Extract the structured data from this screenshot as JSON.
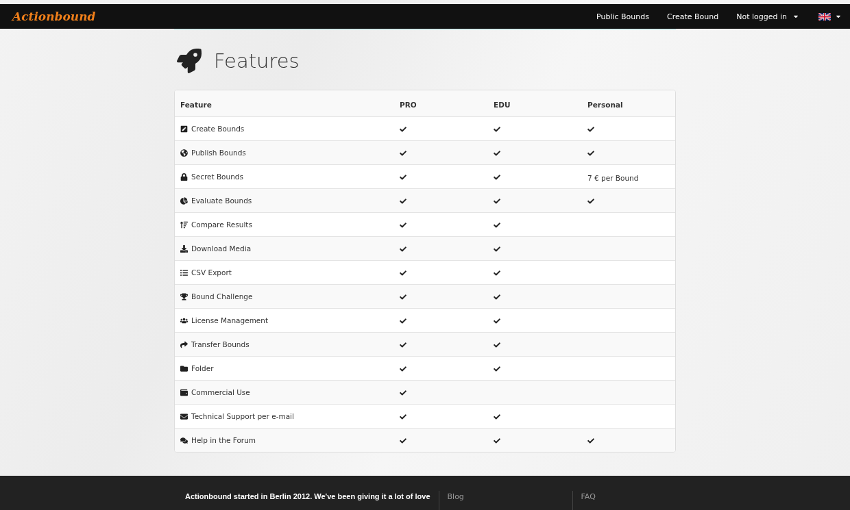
{
  "navbar": {
    "logo": "Actionbound",
    "links": [
      {
        "label": "Public Bounds",
        "kind": "link"
      },
      {
        "label": "Create Bound",
        "kind": "link"
      },
      {
        "label": "Not logged in",
        "kind": "dropdown"
      }
    ],
    "language": {
      "kind": "flag-uk"
    }
  },
  "page": {
    "title": "Features"
  },
  "table": {
    "columns": [
      "Feature",
      "PRO",
      "EDU",
      "Personal"
    ],
    "rows": [
      {
        "cells": [
          {
            "kind": "feature",
            "text": "Create Bounds"
          },
          {
            "kind": "check"
          },
          {
            "kind": "check"
          },
          {
            "kind": "check"
          }
        ]
      },
      {
        "cells": [
          {
            "kind": "feature",
            "text": "Publish Bounds"
          },
          {
            "kind": "check"
          },
          {
            "kind": "check"
          },
          {
            "kind": "check"
          }
        ]
      },
      {
        "cells": [
          {
            "kind": "feature",
            "text": "Secret Bounds"
          },
          {
            "kind": "check"
          },
          {
            "kind": "check"
          },
          {
            "kind": "text",
            "text": "7 € per Bound"
          }
        ]
      },
      {
        "cells": [
          {
            "kind": "feature",
            "text": "Evaluate Bounds"
          },
          {
            "kind": "check"
          },
          {
            "kind": "check"
          },
          {
            "kind": "check"
          }
        ]
      },
      {
        "cells": [
          {
            "kind": "feature",
            "text": "Compare Results"
          },
          {
            "kind": "check"
          },
          {
            "kind": "check"
          },
          {
            "kind": "none"
          }
        ]
      },
      {
        "cells": [
          {
            "kind": "feature",
            "text": "Download Media"
          },
          {
            "kind": "check"
          },
          {
            "kind": "check"
          },
          {
            "kind": "none"
          }
        ]
      },
      {
        "cells": [
          {
            "kind": "feature",
            "text": "CSV Export"
          },
          {
            "kind": "check"
          },
          {
            "kind": "check"
          },
          {
            "kind": "none"
          }
        ]
      },
      {
        "cells": [
          {
            "kind": "feature",
            "text": "Bound Challenge"
          },
          {
            "kind": "check"
          },
          {
            "kind": "check"
          },
          {
            "kind": "none"
          }
        ]
      },
      {
        "cells": [
          {
            "kind": "feature",
            "text": "License Management"
          },
          {
            "kind": "check"
          },
          {
            "kind": "check"
          },
          {
            "kind": "none"
          }
        ]
      },
      {
        "cells": [
          {
            "kind": "feature",
            "text": "Transfer Bounds"
          },
          {
            "kind": "check"
          },
          {
            "kind": "check"
          },
          {
            "kind": "none"
          }
        ]
      },
      {
        "cells": [
          {
            "kind": "feature",
            "text": "Folder"
          },
          {
            "kind": "check"
          },
          {
            "kind": "check"
          },
          {
            "kind": "none"
          }
        ]
      },
      {
        "cells": [
          {
            "kind": "feature",
            "text": "Commercial Use"
          },
          {
            "kind": "check"
          },
          {
            "kind": "none"
          },
          {
            "kind": "none"
          }
        ]
      },
      {
        "cells": [
          {
            "kind": "feature",
            "text": "Technical Support per e-mail"
          },
          {
            "kind": "check"
          },
          {
            "kind": "check"
          },
          {
            "kind": "none"
          }
        ]
      },
      {
        "cells": [
          {
            "kind": "feature",
            "text": "Help in the Forum"
          },
          {
            "kind": "check"
          },
          {
            "kind": "check"
          },
          {
            "kind": "check"
          }
        ]
      }
    ]
  },
  "footer": {
    "about": "Actionbound started in Berlin 2012. We've been giving it a lot of love",
    "columns": [
      [
        "Blog"
      ],
      [
        "FAQ"
      ]
    ]
  }
}
